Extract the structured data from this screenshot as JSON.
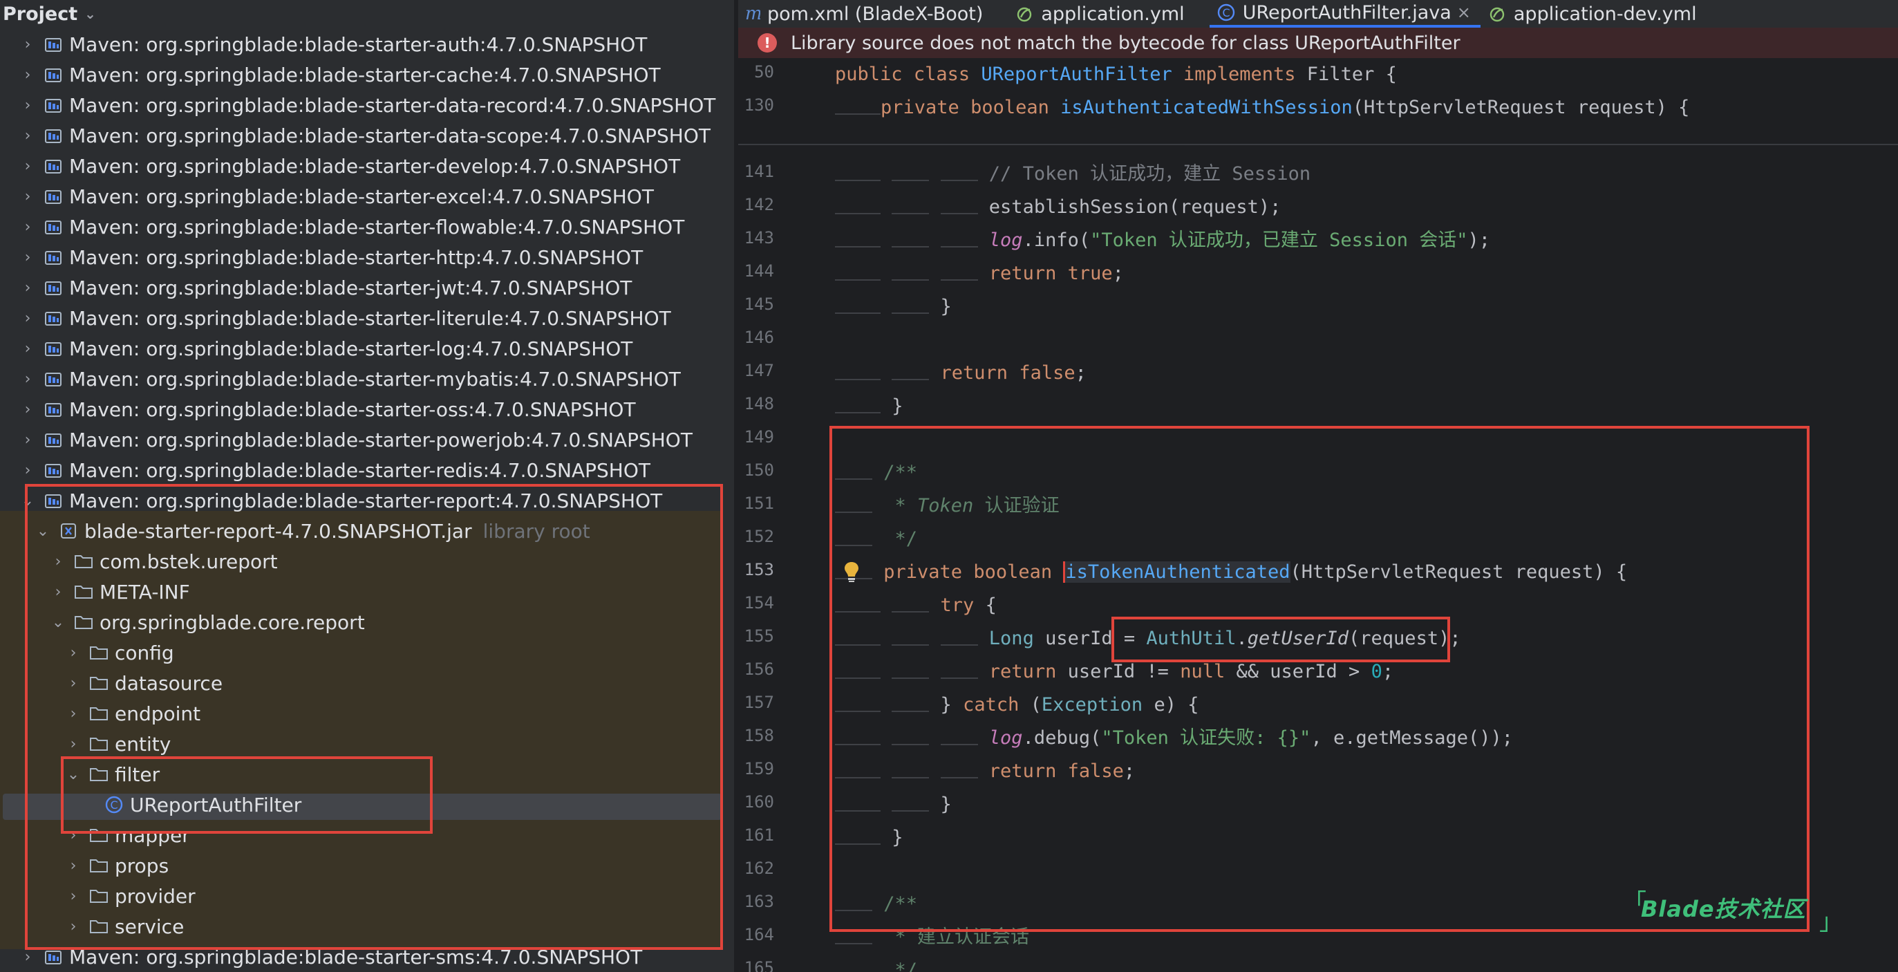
{
  "project": {
    "title": "Project",
    "items": [
      {
        "label": "Maven: org.springblade:blade-starter-auth:4.7.0.SNAPSHOT"
      },
      {
        "label": "Maven: org.springblade:blade-starter-cache:4.7.0.SNAPSHOT"
      },
      {
        "label": "Maven: org.springblade:blade-starter-data-record:4.7.0.SNAPSHOT"
      },
      {
        "label": "Maven: org.springblade:blade-starter-data-scope:4.7.0.SNAPSHOT"
      },
      {
        "label": "Maven: org.springblade:blade-starter-develop:4.7.0.SNAPSHOT"
      },
      {
        "label": "Maven: org.springblade:blade-starter-excel:4.7.0.SNAPSHOT"
      },
      {
        "label": "Maven: org.springblade:blade-starter-flowable:4.7.0.SNAPSHOT"
      },
      {
        "label": "Maven: org.springblade:blade-starter-http:4.7.0.SNAPSHOT"
      },
      {
        "label": "Maven: org.springblade:blade-starter-jwt:4.7.0.SNAPSHOT"
      },
      {
        "label": "Maven: org.springblade:blade-starter-literule:4.7.0.SNAPSHOT"
      },
      {
        "label": "Maven: org.springblade:blade-starter-log:4.7.0.SNAPSHOT"
      },
      {
        "label": "Maven: org.springblade:blade-starter-mybatis:4.7.0.SNAPSHOT"
      },
      {
        "label": "Maven: org.springblade:blade-starter-oss:4.7.0.SNAPSHOT"
      },
      {
        "label": "Maven: org.springblade:blade-starter-powerjob:4.7.0.SNAPSHOT"
      },
      {
        "label": "Maven: org.springblade:blade-starter-redis:4.7.0.SNAPSHOT"
      },
      {
        "label": "Maven: org.springblade:blade-starter-report:4.7.0.SNAPSHOT"
      },
      {
        "label": "blade-starter-report-4.7.0.SNAPSHOT.jar",
        "suffix": "library root"
      },
      {
        "label": "com.bstek.ureport"
      },
      {
        "label": "META-INF"
      },
      {
        "label": "org.springblade.core.report"
      },
      {
        "label": "config"
      },
      {
        "label": "datasource"
      },
      {
        "label": "endpoint"
      },
      {
        "label": "entity"
      },
      {
        "label": "filter"
      },
      {
        "label": "UReportAuthFilter"
      },
      {
        "label": "mapper"
      },
      {
        "label": "props"
      },
      {
        "label": "provider"
      },
      {
        "label": "service"
      },
      {
        "label": "Maven: org.springblade:blade-starter-sms:4.7.0.SNAPSHOT"
      }
    ]
  },
  "tabs": [
    {
      "label": "pom.xml (BladeX-Boot)",
      "icon": "maven-icon"
    },
    {
      "label": "application.yml",
      "icon": "spring-leaf-icon"
    },
    {
      "label": "UReportAuthFilter.java",
      "icon": "class-icon",
      "close": "×"
    },
    {
      "label": "application-dev.yml",
      "icon": "spring-leaf-icon"
    }
  ],
  "banner": {
    "icon": "!",
    "text": "Library source does not match the bytecode for class UReportAuthFilter"
  },
  "editor": {
    "sticky": [
      {
        "ln": "50",
        "t": {
          "a": "public",
          "b": "class",
          "c": "UReportAuthFilter",
          "d": "implements",
          "e": "Filter {"
        }
      },
      {
        "ln": "130",
        "t": {
          "a": "private",
          "b": "boolean",
          "c": "isAuthenticatedWithSession",
          "d": "(HttpServletRequest request) {"
        }
      }
    ],
    "lines": {
      "l141": {
        "ln": "141",
        "a": "// Token 认证成功，建立 Session"
      },
      "l142": {
        "ln": "142",
        "a": "establishSession(request);"
      },
      "l143": {
        "ln": "143",
        "a": "log",
        "b": ".info(",
        "c": "\"Token 认证成功，已建立 Session 会话\"",
        "d": ");"
      },
      "l144": {
        "ln": "144",
        "a": "return",
        "b": "true",
        "c": ";"
      },
      "l145": {
        "ln": "145",
        "a": "}"
      },
      "l146": {
        "ln": "146"
      },
      "l147": {
        "ln": "147",
        "a": "return",
        "b": "false",
        "c": ";"
      },
      "l148": {
        "ln": "148",
        "a": "}"
      },
      "l149": {
        "ln": "149"
      },
      "l150": {
        "ln": "150",
        "a": "/**"
      },
      "l151": {
        "ln": "151",
        "a": "* Token",
        "b": "认证验证"
      },
      "l152": {
        "ln": "152",
        "a": "*/"
      },
      "l153": {
        "ln": "153",
        "a": "private",
        "b": "boolean",
        "c": "isTokenAuthenticated",
        "d": "(HttpServletRequest request) {"
      },
      "l154": {
        "ln": "154",
        "a": "try",
        "b": "{"
      },
      "l155": {
        "ln": "155",
        "a": "Long",
        "b": "userId =",
        "c": "AuthUtil",
        "d": ".",
        "e": "getUserId",
        "f": "(request);"
      },
      "l156": {
        "ln": "156",
        "a": "return",
        "b": "userId !=",
        "c": "null",
        "d": "&& userId >",
        "e": "0",
        "f": ";"
      },
      "l157": {
        "ln": "157",
        "a": "}",
        "b": "catch",
        "c": "(",
        "d": "Exception",
        "e": "e) {"
      },
      "l158": {
        "ln": "158",
        "a": "log",
        "b": ".debug(",
        "c": "\"Token 认证失败: {}\"",
        "d": ", e.getMessage());"
      },
      "l159": {
        "ln": "159",
        "a": "return",
        "b": "false",
        "c": ";"
      },
      "l160": {
        "ln": "160",
        "a": "}"
      },
      "l161": {
        "ln": "161",
        "a": "}"
      },
      "l162": {
        "ln": "162"
      },
      "l163": {
        "ln": "163",
        "a": "/**"
      },
      "l164": {
        "ln": "164",
        "a": "* 建立认证会话"
      },
      "l165": {
        "ln": "165",
        "a": "*/"
      }
    }
  },
  "watermark": {
    "open": "「",
    "text": "Blade技术社区",
    "close": "」"
  },
  "colors": {
    "highlight_red": "#e0443b",
    "accent_blue": "#3574f0"
  }
}
